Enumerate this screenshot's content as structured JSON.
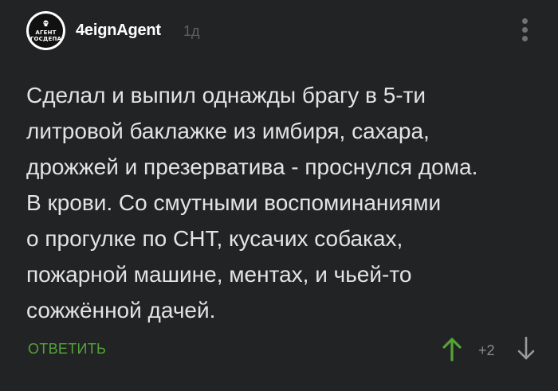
{
  "comment": {
    "author": {
      "avatar_icon": "skull-icon",
      "avatar_line1": "АГЕНТ",
      "avatar_line2": "ГОСДЕПА",
      "username": "4eignAgent",
      "time": "1д"
    },
    "menu_icon": "more-vertical-icon",
    "text": "Сделал и выпил однажды брагу в 5-ти\nлитровой баклажке из имбиря, сахара,\nдрожжей и презерватива - проснулся дома.\nВ крови. Со смутными воспоминаниями\nо прогулке по СНТ, кусачих собаках,\nпожарной машине, ментах, и чьей-то\nсожжённой дачей.",
    "actions": {
      "reply_label": "ОТВЕТИТЬ",
      "vote_up_icon": "arrow-up-icon",
      "vote_down_icon": "arrow-down-icon",
      "rating": "+2"
    }
  },
  "colors": {
    "background": "#222325",
    "text": "#e3e3e3",
    "accent_green": "#55a336",
    "muted": "#5f6062"
  }
}
